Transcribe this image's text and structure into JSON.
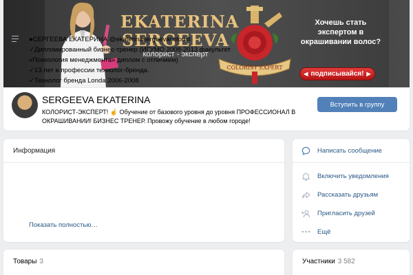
{
  "banner": {
    "brand_line1": "EKATERINA",
    "brand_line2": "SERGEEVA",
    "brand_subtitle": "колорист - эксперт",
    "ribbon_text": "COLORIST EXPERT",
    "promo_text": "Хочешь стать экспертом в окрашивании волос?",
    "subscribe_label": "подписывайся!",
    "subscribe_arrow_left": "◀",
    "subscribe_arrow_right": "▶"
  },
  "header": {
    "title": "SERGEEVA EKATERINA",
    "status": "КОЛОРИСТ-ЭКСПЕРТ! ☝ Обучение от базового уровня до уровня ПРОФЕССИОНАЛ В ОКРАШИВАНИИ! БИЗНЕС ТРЕНЕР. Провожу обучение в любом городе!",
    "join_label": "Вступить в группу"
  },
  "info": {
    "heading": "Информация",
    "lines": [
      "●СЕРГЕЕВА ЕКАТЕРИНА @ekaterinasergeevacolorist",
      "✓Дипломированный бизнес-тренер (ИГУМО 2008-2013 факультет",
      "«Психология менеджмента» диплом с отличием)",
      "✓13 лет в профессии технолог-бренда.",
      "✓Технолог бренда Londa 2006-2008"
    ],
    "show_more": "Показать полностью…"
  },
  "actions": [
    {
      "label": "Написать сообщение",
      "icon": "message-icon"
    },
    {
      "label": "Включить уведомления",
      "icon": "bell-icon"
    },
    {
      "label": "Рассказать друзьям",
      "icon": "share-icon"
    },
    {
      "label": "Пригласить друзей",
      "icon": "invite-icon"
    },
    {
      "label": "Ещё",
      "icon": "more-icon"
    }
  ],
  "goods": {
    "label": "Товары",
    "count": "3"
  },
  "members": {
    "label": "Участники",
    "count": "3 582"
  },
  "colors": {
    "accent": "#5181b8",
    "link": "#2a5885",
    "background": "#edeef0"
  }
}
